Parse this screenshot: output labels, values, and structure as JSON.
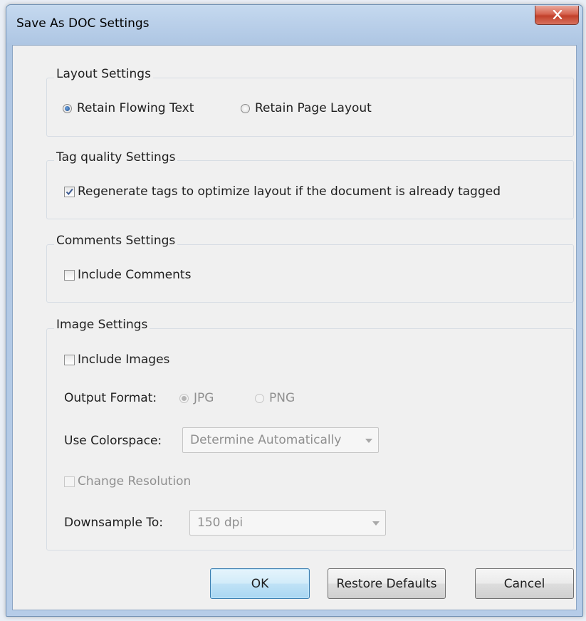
{
  "window": {
    "title": "Save As DOC Settings"
  },
  "layout_settings": {
    "title": "Layout Settings",
    "options": [
      {
        "label": "Retain Flowing Text",
        "selected": true
      },
      {
        "label": "Retain Page Layout",
        "selected": false
      }
    ]
  },
  "tag_quality_settings": {
    "title": "Tag quality Settings",
    "regenerate_label": "Regenerate tags to optimize layout if the document is already tagged",
    "regenerate_checked": true
  },
  "comments_settings": {
    "title": "Comments Settings",
    "include_label": "Include Comments",
    "include_checked": false
  },
  "image_settings": {
    "title": "Image Settings",
    "include_label": "Include Images",
    "include_checked": false,
    "output_format_label": "Output Format:",
    "formats": [
      {
        "label": "JPG",
        "selected": true,
        "enabled": false
      },
      {
        "label": "PNG",
        "selected": false,
        "enabled": false
      }
    ],
    "colorspace_label": "Use Colorspace:",
    "colorspace_value": "Determine Automatically",
    "change_resolution_label": "Change Resolution",
    "change_resolution_checked": false,
    "downsample_label": "Downsample To:",
    "downsample_value": "150 dpi"
  },
  "buttons": {
    "ok": "OK",
    "restore": "Restore Defaults",
    "cancel": "Cancel"
  },
  "colors": {
    "title_bar": "#b9cfe9",
    "close_button": "#c2402a",
    "default_button_border": "#3c7fb1",
    "disabled_text": "#8f8f8f"
  }
}
